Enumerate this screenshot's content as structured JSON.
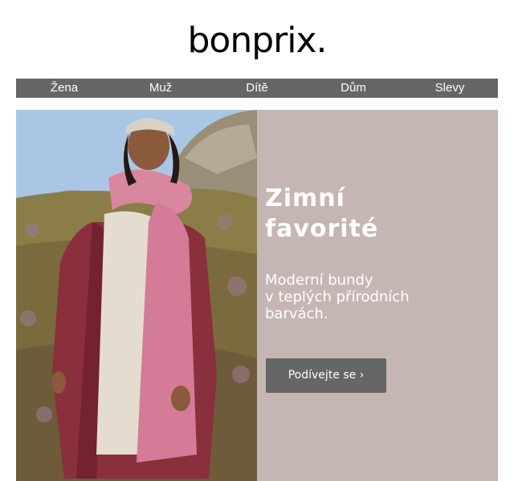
{
  "brand": {
    "logo_text": "bonprix."
  },
  "nav": {
    "items": [
      "Žena",
      "Muž",
      "Dítě",
      "Dům",
      "Slevy"
    ]
  },
  "hero": {
    "headline_line1": "Zimní",
    "headline_line2": "favorité",
    "subtext_line1": "Moderní bundy",
    "subtext_line2": "v teplých přírodních",
    "subtext_line3": "barvách.",
    "cta_label": "Podívejte se ›",
    "panel_color": "#c5b6b4",
    "button_color": "#666666",
    "nav_color": "#666666"
  }
}
